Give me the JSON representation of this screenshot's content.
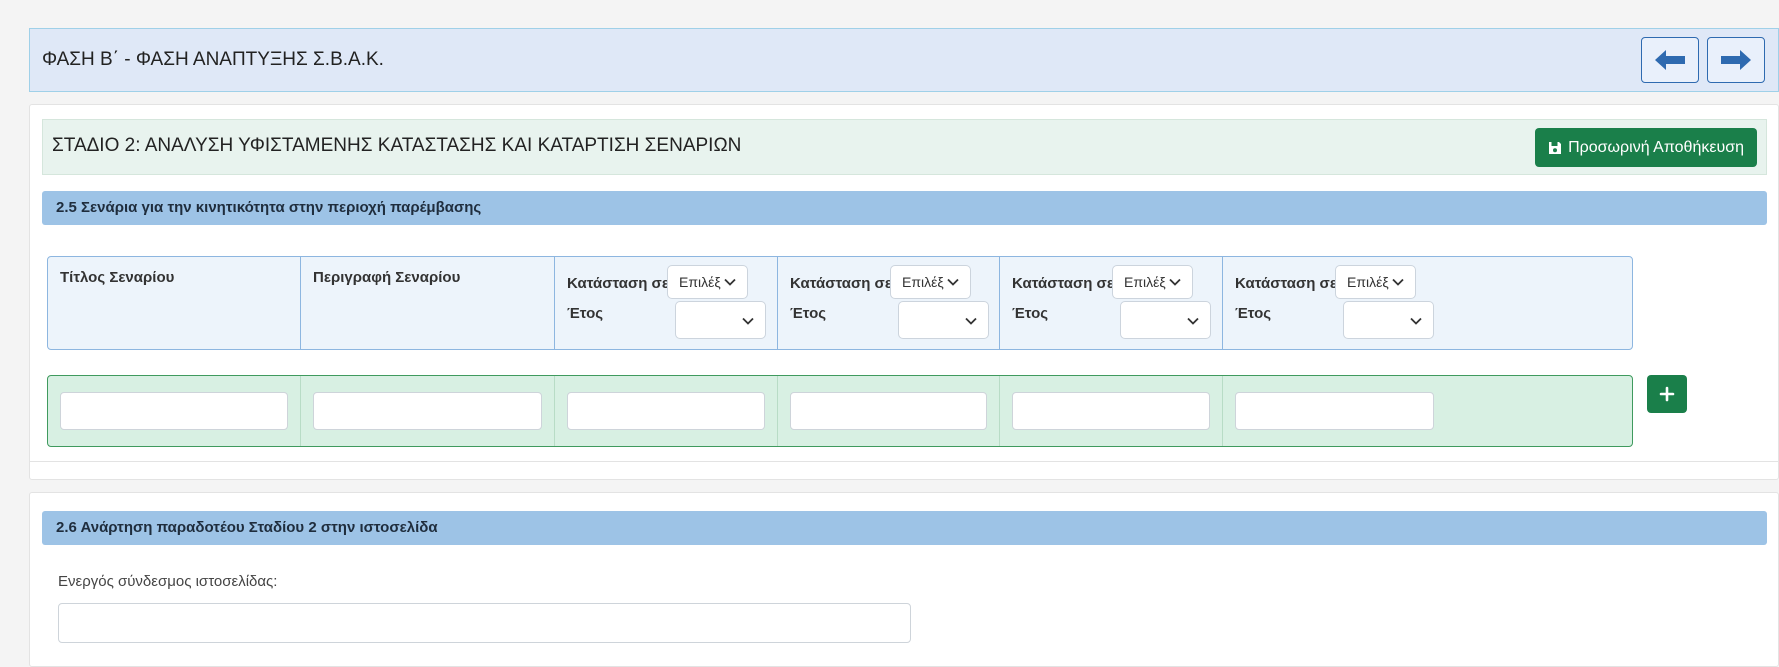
{
  "phase": {
    "title": "ΦΑΣΗ Β΄ - ΦΑΣΗ ΑΝΑΠΤΥΞΗΣ Σ.Β.Α.Κ.",
    "prev_icon": "arrow-left-icon",
    "next_icon": "arrow-right-icon",
    "accent_color": "#2e6ab0"
  },
  "stage": {
    "title": "ΣΤΑΔΙΟ 2: ΑΝΑΛΥΣΗ ΥΦΙΣΤΑΜΕΝΗΣ ΚΑΤΑΣΤΑΣΗΣ ΚΑΙ ΚΑΤΑΡΤΙΣΗ ΣΕΝΑΡΙΩΝ",
    "save_label": "Προσωρινή Αποθήκευση",
    "save_icon": "save-icon",
    "save_color": "#1a7f4a"
  },
  "section25": {
    "title": "2.5 Σενάρια για την κινητικότητα στην περιοχή παρέμβασης",
    "col_title": "Τίτλος Σεναρίου",
    "col_description": "Περιγραφή Σεναρίου",
    "scenario_columns": [
      {
        "state_label": "Κατάσταση σε",
        "state_select": "Επιλέξ",
        "year_label": "Έτος",
        "year_select": ""
      },
      {
        "state_label": "Κατάσταση σε",
        "state_select": "Επιλέξ",
        "year_label": "Έτος",
        "year_select": ""
      },
      {
        "state_label": "Κατάσταση σε",
        "state_select": "Επιλέξ",
        "year_label": "Έτος",
        "year_select": ""
      },
      {
        "state_label": "Κατάσταση σε",
        "state_select": "Επιλέξ",
        "year_label": "Έτος",
        "year_select": ""
      }
    ],
    "row_values": [
      "",
      "",
      "",
      "",
      "",
      ""
    ],
    "add_icon": "plus-icon"
  },
  "section26": {
    "title": "2.6 Ανάρτηση παραδοτέου Σταδίου 2 στην ιστοσελίδα",
    "link_label": "Ενεργός σύνδεσμος ιστοσελίδας:",
    "link_value": ""
  }
}
